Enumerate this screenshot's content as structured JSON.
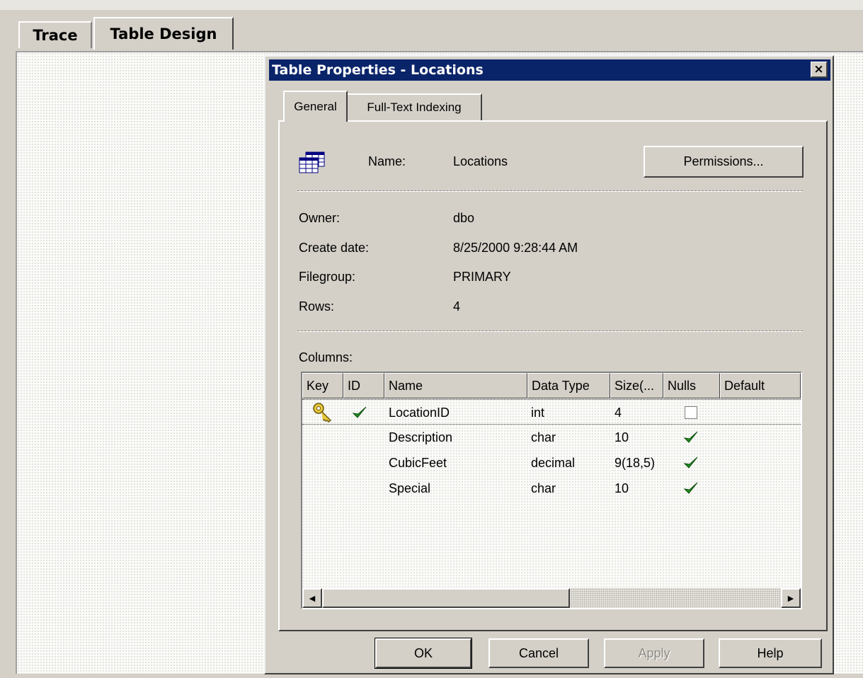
{
  "outer_tabs": [
    {
      "label": "Trace"
    },
    {
      "label": "Table Design"
    }
  ],
  "dialog": {
    "title": "Table Properties - Locations",
    "close_label": "×",
    "tabs": [
      {
        "label": "General"
      },
      {
        "label": "Full-Text Indexing"
      }
    ],
    "name_label": "Name:",
    "name_value": "Locations",
    "permissions_label": "Permissions...",
    "owner_label": "Owner:",
    "owner_value": "dbo",
    "create_date_label": "Create date:",
    "create_date_value": "8/25/2000 9:28:44 AM",
    "filegroup_label": "Filegroup:",
    "filegroup_value": "PRIMARY",
    "rows_label": "Rows:",
    "rows_value": "4",
    "columns_label": "Columns:",
    "grid_headers": [
      "Key",
      "ID",
      "Name",
      "Data Type",
      "Size(...",
      "Nulls",
      "Default"
    ],
    "grid_rows": [
      {
        "key": true,
        "id": true,
        "name": "LocationID",
        "data_type": "int",
        "size": "4",
        "nulls": false
      },
      {
        "key": false,
        "id": false,
        "name": "Description",
        "data_type": "char",
        "size": "10",
        "nulls": true
      },
      {
        "key": false,
        "id": false,
        "name": "CubicFeet",
        "data_type": "decimal",
        "size": "9(18,5)",
        "nulls": true
      },
      {
        "key": false,
        "id": false,
        "name": "Special",
        "data_type": "char",
        "size": "10",
        "nulls": true
      }
    ],
    "buttons": {
      "ok": "OK",
      "cancel": "Cancel",
      "apply": "Apply",
      "help": "Help"
    }
  },
  "icons": {
    "table": "table-icon",
    "key": "key-icon",
    "check": "checkmark-icon",
    "scroll_left": "arrow-left-icon",
    "scroll_right": "arrow-right-icon"
  },
  "colors": {
    "titlebar": "#0a246a",
    "face": "#d4d0c8",
    "check": "#1f8a1f"
  }
}
